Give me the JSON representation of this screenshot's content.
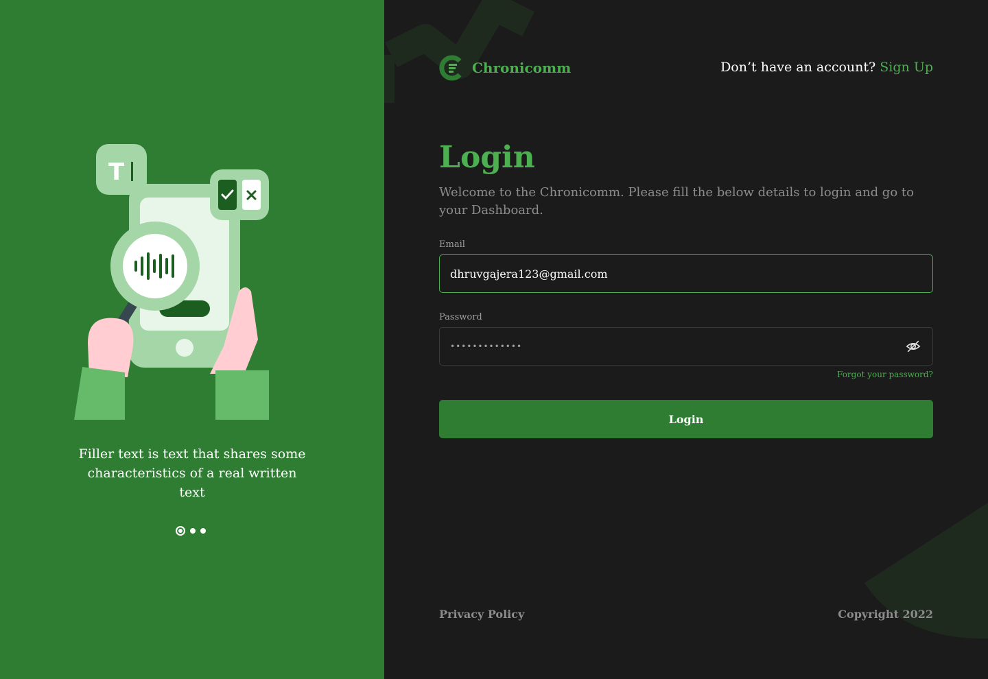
{
  "carousel": {
    "tagline": "Filler text is text that shares some characteristics of a real written text",
    "slides": 3,
    "active_index": 0
  },
  "brand": {
    "name": "Chronicomm",
    "logo_icon": "chronicomm-logo-icon"
  },
  "header": {
    "prompt": "Don’t have an account?",
    "signup_label": "Sign Up"
  },
  "login": {
    "title": "Login",
    "subtitle": "Welcome to the Chronicomm. Please fill the below details to login and go to your Dashboard.",
    "email_label": "Email",
    "email_value": "dhruvgajera123@gmail.com",
    "password_label": "Password",
    "password_value": "•••••••••••••",
    "password_toggle_icon": "eye-off-icon",
    "forgot_label": "Forgot your password?",
    "submit_label": "Login"
  },
  "footer": {
    "privacy_label": "Privacy Policy",
    "copyright": "Copyright 2022"
  },
  "colors": {
    "accent": "#4caf50",
    "panel_green": "#2e7d32",
    "background": "#1b1b1b"
  }
}
